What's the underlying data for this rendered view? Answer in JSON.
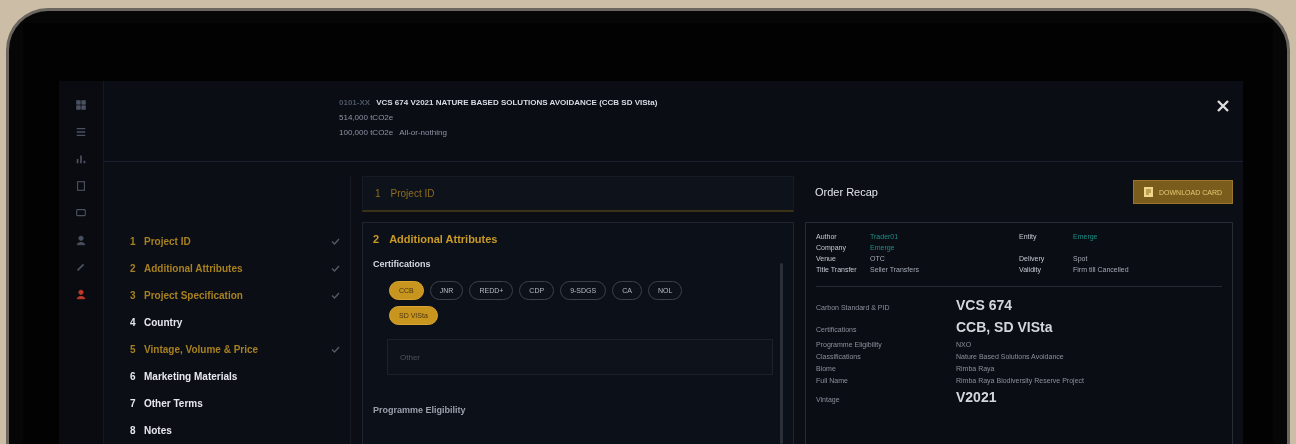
{
  "header": {
    "code": "0101-XX",
    "title": "VCS 674 V2021 NATURE BASED SOLUTIONS AVOIDANCE (CCB SD VISta)",
    "volume": "514,000 tCO2e",
    "quantity": "100,000 tCO2e",
    "fill_type": "All-or-nothing"
  },
  "rail_icons": [
    {
      "kind": "grid",
      "selected": false
    },
    {
      "kind": "list",
      "selected": false
    },
    {
      "kind": "chart",
      "selected": false
    },
    {
      "kind": "doc",
      "selected": false
    },
    {
      "kind": "chat",
      "selected": false
    },
    {
      "kind": "user",
      "selected": false
    },
    {
      "kind": "tool",
      "selected": false
    },
    {
      "kind": "user",
      "selected": true
    }
  ],
  "steps": [
    {
      "number": "1",
      "label": "Project ID",
      "completed": true
    },
    {
      "number": "2",
      "label": "Additional Attributes",
      "completed": true
    },
    {
      "number": "3",
      "label": "Project Specification",
      "completed": true
    },
    {
      "number": "4",
      "label": "Country",
      "completed": false
    },
    {
      "number": "5",
      "label": "Vintage, Volume & Price",
      "completed": true
    },
    {
      "number": "6",
      "label": "Marketing Materials",
      "completed": false
    },
    {
      "number": "7",
      "label": "Other Terms",
      "completed": false
    },
    {
      "number": "8",
      "label": "Notes",
      "completed": false
    }
  ],
  "collapsed_section": {
    "number": "1",
    "title": "Project ID"
  },
  "open_section": {
    "number": "2",
    "title": "Additional Attributes",
    "certifications_label": "Certifications",
    "chips": [
      {
        "label": "CCB",
        "selected": true
      },
      {
        "label": "JNR",
        "selected": false
      },
      {
        "label": "REDD+",
        "selected": false
      },
      {
        "label": "CDP",
        "selected": false
      },
      {
        "label": "9-SDGS",
        "selected": false
      },
      {
        "label": "CA",
        "selected": false
      },
      {
        "label": "NOL",
        "selected": false
      },
      {
        "label": "SD VISta",
        "selected": true
      }
    ],
    "other_field": {
      "placeholder": "Other"
    },
    "next_label": "Programme Eligibility"
  },
  "recap": {
    "title": "Order Recap",
    "button": "DOWNLOAD CARD",
    "meta_rows": [
      {
        "left": {
          "label": "Author",
          "value": "Trader01",
          "link": true
        },
        "right": {
          "label": "Entity",
          "value": "Emerge",
          "link": true
        }
      },
      {
        "left": {
          "label": "Company",
          "value": "Emerge",
          "link": true
        }
      },
      {
        "left": {
          "label": "Venue",
          "value": "OTC",
          "link": false
        },
        "right": {
          "label": "Delivery",
          "value": "Spot",
          "link": false
        }
      },
      {
        "left": {
          "label": "Title Transfer",
          "value": "Seller Transfers",
          "link": false
        },
        "right": {
          "label": "Validity",
          "value": "Firm till Cancelled",
          "link": false
        }
      }
    ],
    "details": [
      {
        "label": "Carbon Standard & PID",
        "value": "VCS 674",
        "emphasis": true
      },
      {
        "label": "Certifications",
        "value": "CCB, SD VISta",
        "emphasis": true
      },
      {
        "label": "Programme Eligibility",
        "value": "NXO",
        "emphasis": false
      },
      {
        "label": "Classifications",
        "value": "Nature Based Solutions Avoidance",
        "emphasis": false
      },
      {
        "label": "Biome",
        "value": "Rimba Raya",
        "emphasis": false
      },
      {
        "label": "Full Name",
        "value": "Rimba Raya Biodiversity Reserve Project",
        "emphasis": false
      },
      {
        "label": "Vintage",
        "value": "V2021",
        "emphasis": true
      }
    ]
  }
}
